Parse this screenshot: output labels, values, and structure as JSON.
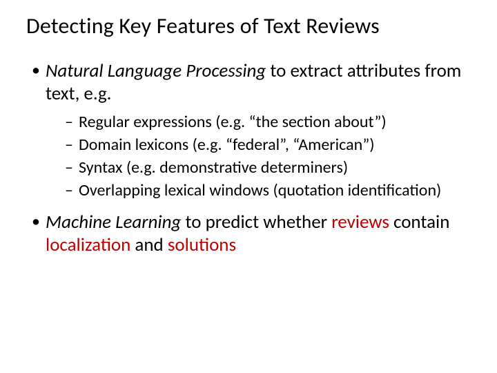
{
  "title": "Detecting Key Features of Text Reviews",
  "bullets": [
    {
      "emph": "Natural Language Processing",
      "rest": " to extract attributes from text, e.g.",
      "sub": [
        "Regular expressions (e.g. “the section about”)",
        "Domain lexicons (e.g. “federal”, “American”)",
        "Syntax (e.g. demonstrative determiners)",
        "Overlapping lexical windows (quotation identification)"
      ]
    },
    {
      "emph": "Machine Learning",
      "rest_pre": " to predict whether ",
      "hl1": "reviews",
      "mid1": " contain ",
      "hl2": "localization",
      "mid2": " and  ",
      "hl3": "solutions"
    }
  ]
}
